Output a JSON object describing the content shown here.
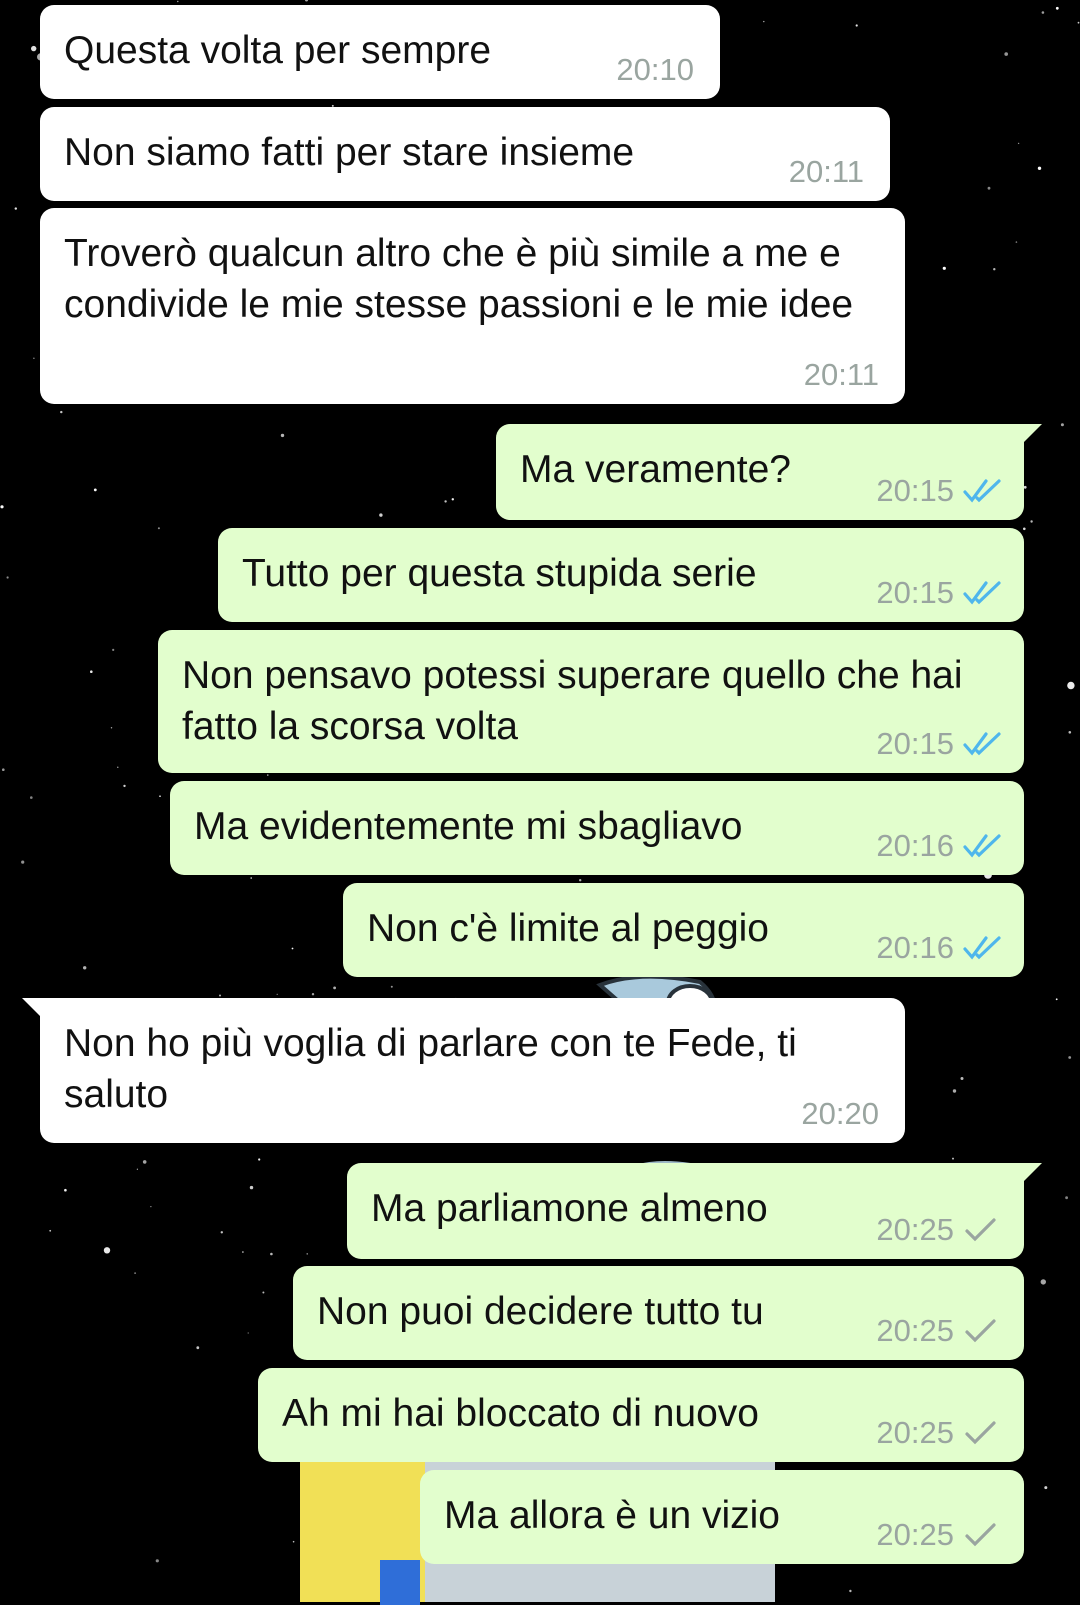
{
  "chat": {
    "messages": [
      {
        "direction": "in",
        "text": "Questa volta per sempre",
        "time": "20:10"
      },
      {
        "direction": "in",
        "text": "Non siamo fatti per stare insieme",
        "time": "20:11"
      },
      {
        "direction": "in",
        "text": "Troverò qualcun altro che è più simile a me e condivide le mie stesse passioni e le mie idee",
        "time": "20:11"
      },
      {
        "direction": "out",
        "text": "Ma veramente?",
        "time": "20:15",
        "status": "read"
      },
      {
        "direction": "out",
        "text": "Tutto per questa stupida serie",
        "time": "20:15",
        "status": "read"
      },
      {
        "direction": "out",
        "text": "Non pensavo potessi superare quello che hai fatto la scorsa volta",
        "time": "20:15",
        "status": "read"
      },
      {
        "direction": "out",
        "text": "Ma evidentemente mi sbagliavo",
        "time": "20:16",
        "status": "read"
      },
      {
        "direction": "out",
        "text": "Non c'è limite al peggio",
        "time": "20:16",
        "status": "read"
      },
      {
        "direction": "in",
        "text": "Non ho più voglia di parlare con te Fede, ti saluto",
        "time": "20:20"
      },
      {
        "direction": "out",
        "text": "Ma parliamone almeno",
        "time": "20:25",
        "status": "sent"
      },
      {
        "direction": "out",
        "text": "Non puoi decidere tutto tu",
        "time": "20:25",
        "status": "sent"
      },
      {
        "direction": "out",
        "text": "Ah mi hai bloccato di nuovo",
        "time": "20:25",
        "status": "sent"
      },
      {
        "direction": "out",
        "text": "Ma allora è un vizio",
        "time": "20:25",
        "status": "sent"
      }
    ]
  },
  "colors": {
    "background": "#000000",
    "incoming_bubble": "#ffffff",
    "outgoing_bubble": "#e2fecd",
    "read_tick": "#4fb6ec",
    "sent_tick": "#9aa5a0",
    "timestamp": "#9aa5a0"
  },
  "icons": {
    "read": "double-check-icon",
    "sent": "single-check-icon"
  }
}
